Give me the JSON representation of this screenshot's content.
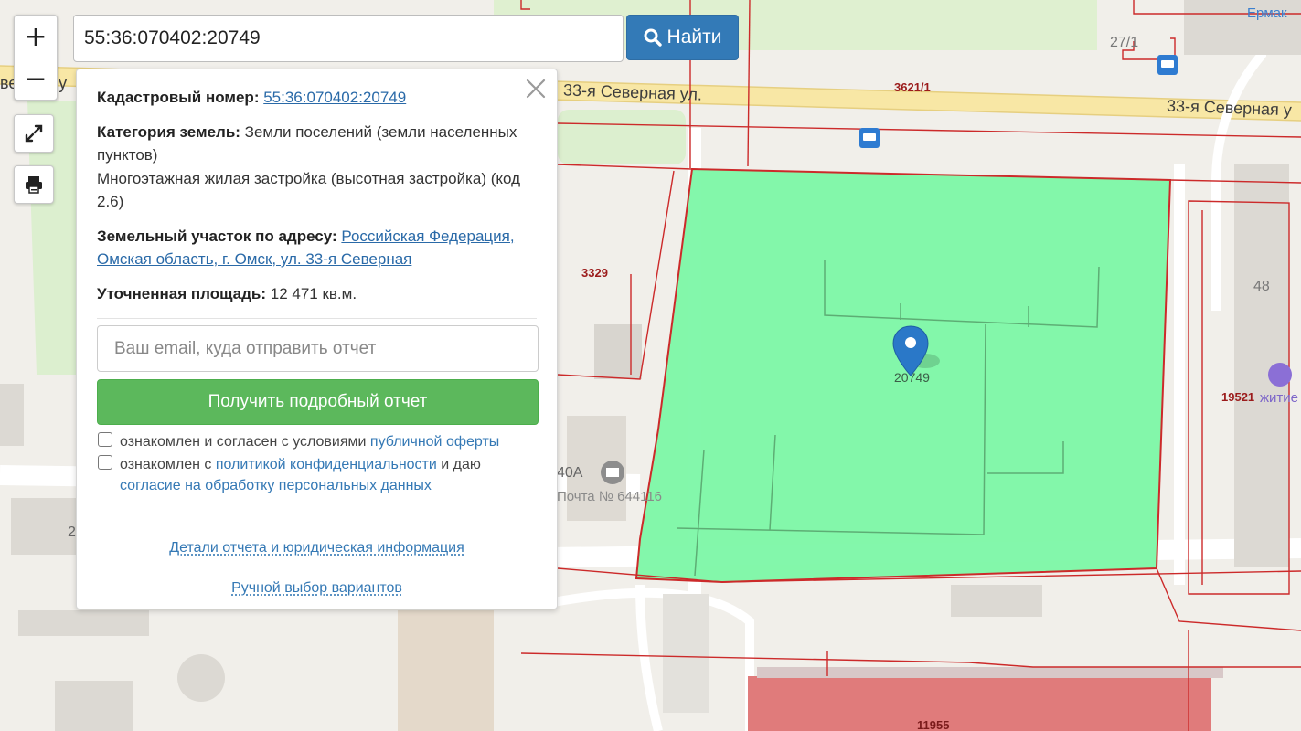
{
  "search": {
    "value": "55:36:070402:20749",
    "button_label": "Найти"
  },
  "zoom": {
    "in_label": "+",
    "out_label": "−"
  },
  "info": {
    "cadastral_label": "Кадастровый номер:",
    "cadastral_value": "55:36:070402:20749",
    "category_label": "Категория земель:",
    "category_value": "Земли поселений (земли населенных пунктов)",
    "usage_value": "Многоэтажная жилая застройка (высотная застройка) (код 2.6)",
    "address_label": "Земельный участок по адресу:",
    "address_value": "Российская Федерация, Омская область, г. Омск, ул. 33-я Северная",
    "area_label": "Уточненная площадь:",
    "area_value": "12 471 кв.м."
  },
  "report": {
    "email_placeholder": "Ваш email, куда отправить отчет",
    "button_label": "Получить подробный отчет",
    "consent1_text": "ознакомлен и согласен с условиями",
    "consent1_link": "публичной оферты",
    "consent2_text": "ознакомлен с",
    "consent2_link": "политикой конфиденциальности",
    "consent2_mid": "и даю",
    "consent2_link2": "согласие на обработку персональных данных"
  },
  "footer": {
    "details_link": "Детали отчета и юридическая информация",
    "manual_link": "Ручной выбор вариантов"
  },
  "map": {
    "street_main": "33-я Северная ул.",
    "street_right": "33-я Северная у",
    "street_left": "верная у",
    "parcel_label": "20749",
    "cad_3621": "3621/1",
    "cad_3329": "3329",
    "cad_19521": "19521",
    "cad_11955": "11955",
    "house_27": "27/1",
    "house_48": "48",
    "house_40a": "40А",
    "house_2": "2",
    "post_office": "Почта № 644116",
    "poi_yermak": "Ермак",
    "poi_hostel": "житие",
    "colors": {
      "parcel_fill": "#7cf7a6",
      "parcel_border": "#cc2a2a",
      "marker": "#2a78c8",
      "building_red": "#e07b7b"
    }
  }
}
